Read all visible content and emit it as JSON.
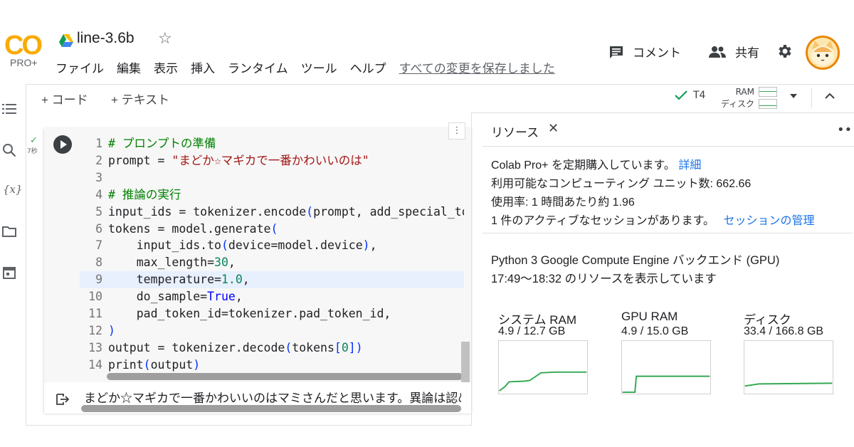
{
  "logo": {
    "text": "CO",
    "sub": "PRO+"
  },
  "header": {
    "title": "line-3.6b",
    "menu": [
      "ファイル",
      "編集",
      "表示",
      "挿入",
      "ランタイム",
      "ツール",
      "ヘルプ"
    ],
    "saved_status": "すべての変更を保存しました",
    "comment_label": "コメント",
    "share_label": "共有"
  },
  "toolbar": {
    "add_code": "+ コード",
    "add_text": "+ テキスト",
    "runtime": "T4",
    "ram_label": "RAM",
    "disk_label": "ディスク"
  },
  "rail": {
    "icons": [
      "list-icon",
      "search-icon",
      "variables-icon",
      "folder-icon",
      "calendar-icon"
    ]
  },
  "cell": {
    "status": "✓",
    "exec_time": "7秒",
    "menu_glyph": "⋮",
    "output": "まどか☆マギカで一番かわいいのはマミさんだと思います。異論は認めません。"
  },
  "code_lines": [
    "# プロンプトの準備",
    "prompt = \"まどか☆マギカで一番かわいいのは\"",
    "",
    "# 推論の実行",
    "input_ids = tokenizer.encode(prompt, add_special_tokens=False, return_tensors=\"pt\")",
    "tokens = model.generate(",
    "    input_ids.to(device=model.device),",
    "    max_length=30,",
    "    temperature=1.0,",
    "    do_sample=True,",
    "    pad_token_id=tokenizer.pad_token_id,",
    ")",
    "output = tokenizer.decode(tokens[0])",
    "print(output)"
  ],
  "resources": {
    "tab_label": "リソース",
    "close_glyph": "✕",
    "kebab": "•••",
    "line1": "Colab Pro+ を定期購入しています。",
    "line1_link": "詳細",
    "line2": "利用可能なコンピューティング ユニット数: 662.66",
    "line3": "使用率: 1 時間あたり約 1.96",
    "line4": "1 件のアクティブなセッションがあります。",
    "line4_link": "セッションの管理",
    "backend": "Python 3 Google Compute Engine バックエンド (GPU)",
    "range": "17:49〜18:32 のリソースを表示しています",
    "meters": [
      {
        "title": "システム RAM",
        "value": "4.9 / 12.7 GB",
        "fraction": 0.386
      },
      {
        "title": "GPU RAM",
        "value": "4.9 / 15.0 GB",
        "fraction": 0.327
      },
      {
        "title": "ディスク",
        "value": "33.4 / 166.8 GB",
        "fraction": 0.2
      }
    ]
  },
  "colors": {
    "accent": "#1a73e8",
    "green": "#34a853",
    "logo_yellow": "#f9ab00",
    "logo_orange": "#e8710a"
  }
}
